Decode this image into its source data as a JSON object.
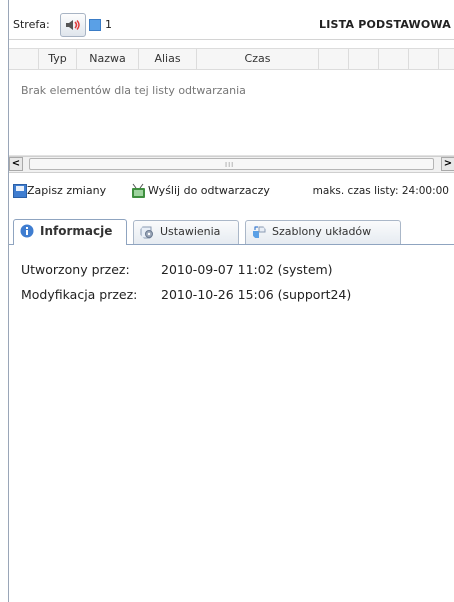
{
  "top": {
    "strefa_label": "Strefa:",
    "strefa_count": "1",
    "list_title": "LISTA PODSTAWOWA"
  },
  "grid": {
    "columns": [
      "Typ",
      "Nazwa",
      "Alias",
      "Czas"
    ],
    "empty_message": "Brak elementów dla tej listy odtwarzania"
  },
  "scrollbar": {
    "left_arrow": "<",
    "right_arrow": ">",
    "grip": "III"
  },
  "toolbar": {
    "save_label": "Zapisz zmiany",
    "send_label": "Wyślij do odtwarzaczy",
    "max_time_label": "maks. czas listy: 24:00:00"
  },
  "tabs": [
    {
      "label": "Informacje",
      "icon": "info-icon"
    },
    {
      "label": "Ustawienia",
      "icon": "settings-icon"
    },
    {
      "label": "Szablony układów",
      "icon": "layout-icon"
    }
  ],
  "info": {
    "created_label": "Utworzony przez:",
    "created_value": "2010-09-07 11:02 (system)",
    "modified_label": "Modyfikacja przez:",
    "modified_value": "2010-10-26 15:06 (support24)"
  },
  "colors": {
    "accent": "#3f7dd0",
    "zone_indicator": "#5aa0e6",
    "speaker_red": "#e03a3a"
  }
}
